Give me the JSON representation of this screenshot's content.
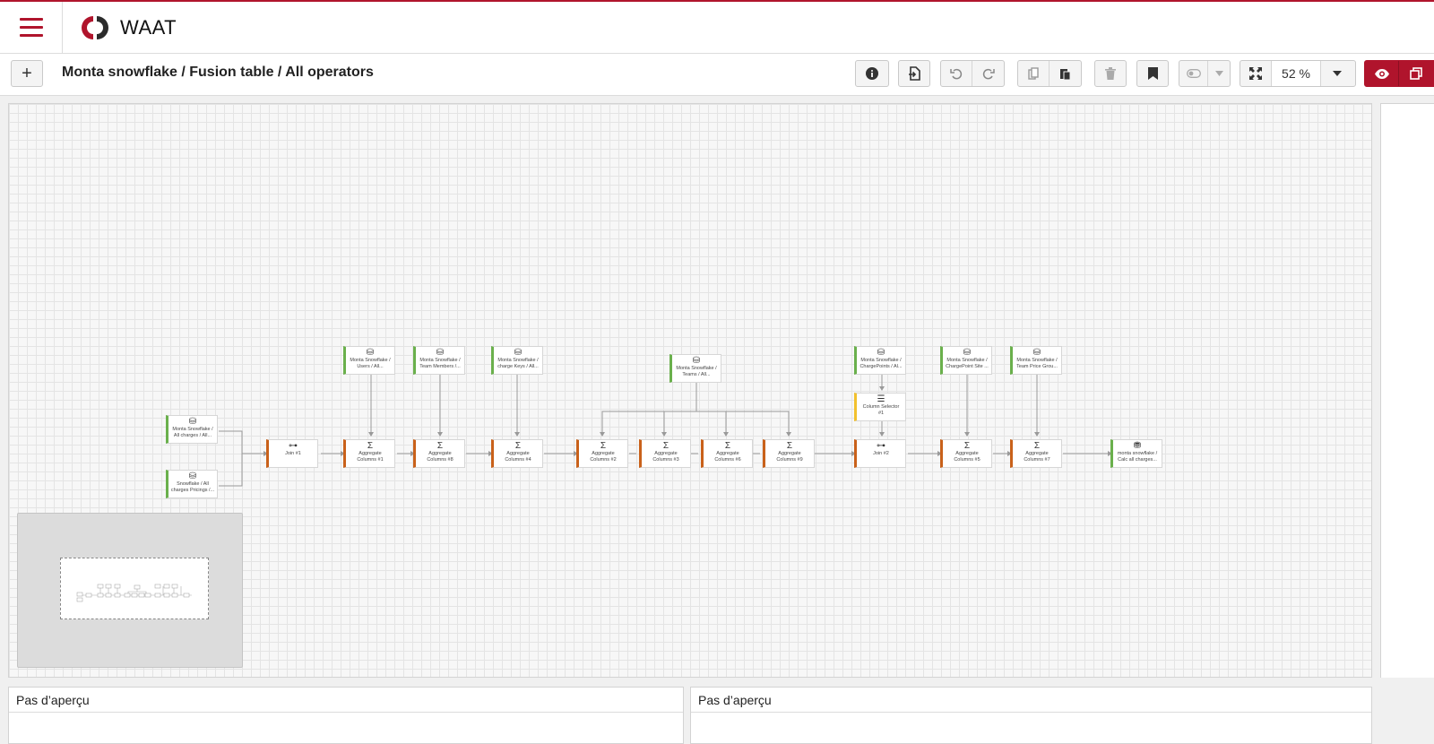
{
  "app": {
    "name": "WAAT"
  },
  "toolbar": {
    "add_label": "+",
    "breadcrumb": "Monta snowflake / Fusion table / All operators",
    "zoom": "52 %"
  },
  "nodes": {
    "n1": {
      "lines": [
        "Monta Snowflake /",
        "All charges / All..."
      ]
    },
    "n2": {
      "lines": [
        "Snowflake / All",
        "charges Pricings /..."
      ]
    },
    "n3": {
      "lines": [
        "Join #1"
      ]
    },
    "n4": {
      "lines": [
        "Monta Snowflake /",
        "Users / All..."
      ]
    },
    "n5": {
      "lines": [
        "Aggregate",
        "Columns #1"
      ]
    },
    "n6": {
      "lines": [
        "Monta Snowflake /",
        "Team Members /..."
      ]
    },
    "n7": {
      "lines": [
        "Aggregate",
        "Columns #8"
      ]
    },
    "n8": {
      "lines": [
        "Monta Snowflake /",
        "charge Keys / All..."
      ]
    },
    "n9": {
      "lines": [
        "Aggregate",
        "Columns #4"
      ]
    },
    "n10": {
      "lines": [
        "Monta Snowflake /",
        "Teams / All..."
      ]
    },
    "n11": {
      "lines": [
        "Aggregate",
        "Columns #2"
      ]
    },
    "n12": {
      "lines": [
        "Aggregate",
        "Columns #3"
      ]
    },
    "n13": {
      "lines": [
        "Aggregate",
        "Columns #6"
      ]
    },
    "n14": {
      "lines": [
        "Aggregate",
        "Columns #9"
      ]
    },
    "n15": {
      "lines": [
        "Monta Snowflake /",
        "ChargePoints / Al..."
      ]
    },
    "n16": {
      "lines": [
        "Column Selector",
        "#1"
      ]
    },
    "n17": {
      "lines": [
        "Join #2"
      ]
    },
    "n18": {
      "lines": [
        "Monta Snowflake /",
        "ChargePoint Site ..."
      ]
    },
    "n19": {
      "lines": [
        "Aggregate",
        "Columns #5"
      ]
    },
    "n20": {
      "lines": [
        "Monta Snowflake /",
        "Team Price Grou..."
      ]
    },
    "n21": {
      "lines": [
        "Aggregate",
        "Columns #7"
      ]
    },
    "n22": {
      "lines": [
        "monta snowflake /",
        "Calc all charges..."
      ]
    }
  },
  "preview": {
    "left_title": "Pas d’aperçu",
    "right_title": "Pas d’aperçu"
  },
  "colors": {
    "brand": "#b0142c",
    "dataset": "#6ab04c",
    "operator": "#c9611a",
    "selector": "#f2c12e"
  }
}
